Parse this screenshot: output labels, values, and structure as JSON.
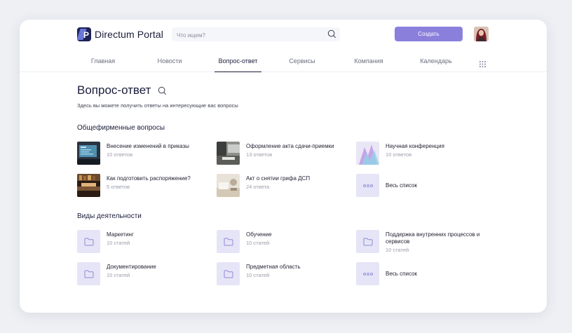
{
  "header": {
    "brand": "Directum Portal",
    "search_placeholder": "Что ищем?",
    "create_label": "Создать"
  },
  "nav": {
    "tabs": [
      {
        "label": "Главная"
      },
      {
        "label": "Новости"
      },
      {
        "label": "Вопрос-ответ",
        "active": true
      },
      {
        "label": "Сервисы"
      },
      {
        "label": "Компания"
      },
      {
        "label": "Календарь"
      }
    ]
  },
  "page": {
    "title": "Вопрос-ответ",
    "subtitle": "Здесь вы можете получить ответы на интересующие вас вопросы"
  },
  "general": {
    "title": "Общефирменные вопросы",
    "items": [
      {
        "title": "Внесение изменений в приказы",
        "meta": "10 ответов",
        "icon": "photo-monitor"
      },
      {
        "title": "Оформление акта сдачи-приемки",
        "meta": "13 ответов",
        "icon": "photo-office"
      },
      {
        "title": "Научная конференция",
        "meta": "10 ответов",
        "icon": "photo-abstract"
      },
      {
        "title": "Как подготовить распоряжение?",
        "meta": "5 ответов",
        "icon": "photo-library"
      },
      {
        "title": "Акт о снятии грифа ДСП",
        "meta": "24 ответа",
        "icon": "photo-desk"
      },
      {
        "title": "Весь список",
        "icon": "more-dots-icon"
      }
    ]
  },
  "activities": {
    "title": "Виды деятельности",
    "items": [
      {
        "title": "Маркетинг",
        "meta": "10 статей",
        "icon": "folder-icon"
      },
      {
        "title": "Обучение",
        "meta": "10 статей",
        "icon": "folder-icon"
      },
      {
        "title": "Поддержка внутренних процессов и сервисов",
        "meta": "10 статей",
        "icon": "folder-icon"
      },
      {
        "title": "Документирование",
        "meta": "10 статей",
        "icon": "folder-icon"
      },
      {
        "title": "Предметная область",
        "meta": "10 статей",
        "icon": "folder-icon"
      },
      {
        "title": "Весь список",
        "icon": "more-dots-icon"
      }
    ]
  },
  "colors": {
    "accent": "#8a80db",
    "tile": "#e6e5f7",
    "icon": "#8f8ad6",
    "brand_dark": "#1d2257"
  }
}
